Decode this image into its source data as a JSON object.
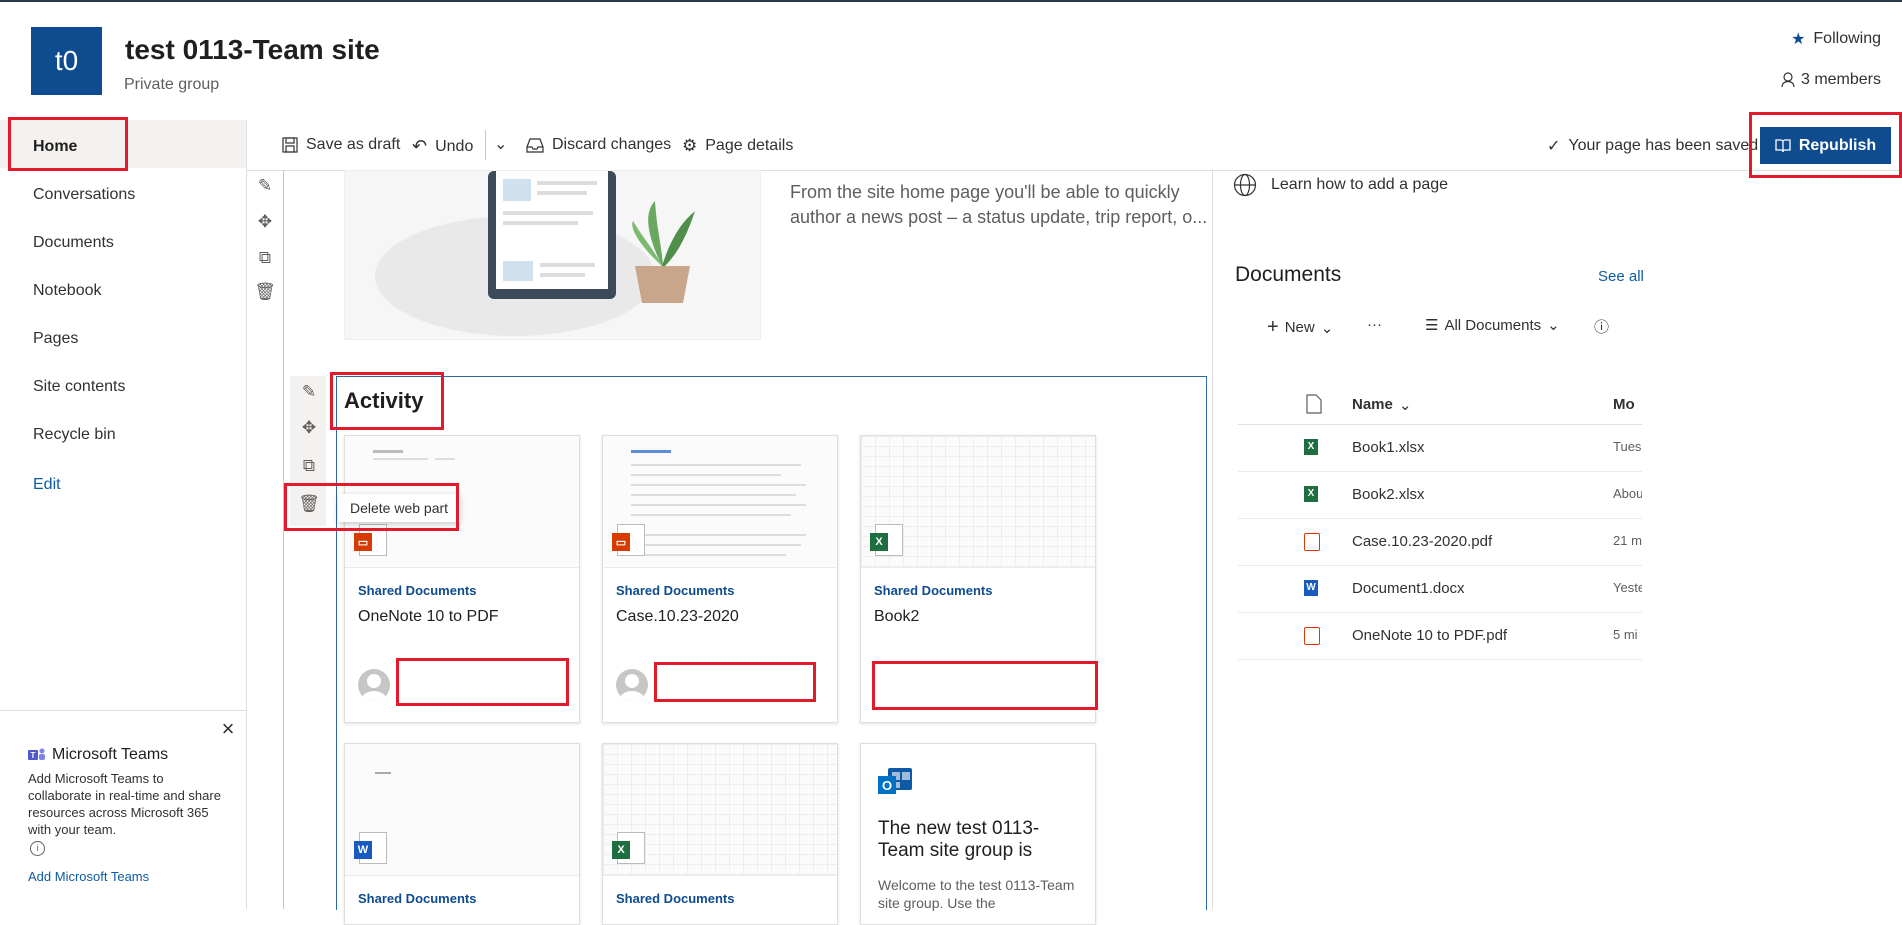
{
  "site": {
    "logo_text": "t0",
    "title": "test 0113-Team site",
    "subtitle": "Private group",
    "following": "Following",
    "members": "3 members"
  },
  "nav": {
    "items": [
      {
        "label": "Home"
      },
      {
        "label": "Conversations"
      },
      {
        "label": "Documents"
      },
      {
        "label": "Notebook"
      },
      {
        "label": "Pages"
      },
      {
        "label": "Site contents"
      },
      {
        "label": "Recycle bin"
      },
      {
        "label": "Edit"
      }
    ]
  },
  "toolbar": {
    "save_draft": "Save as draft",
    "undo": "Undo",
    "discard": "Discard changes",
    "page_details": "Page details",
    "saved_status": "Your page has been saved",
    "republish": "Republish"
  },
  "hero": {
    "text": "From the site home page you'll be able to quickly author a news post – a status update, trip report, o..."
  },
  "activity": {
    "title": "Activity",
    "tooltip": "Delete web part",
    "cards": [
      {
        "library": "Shared Documents",
        "name": "OneNote 10 to PDF"
      },
      {
        "library": "Shared Documents",
        "name": "Case.10.23-2020"
      },
      {
        "library": "Shared Documents",
        "name": "Book2"
      },
      {
        "library": "Shared Documents",
        "name": ""
      },
      {
        "library": "Shared Documents",
        "name": ""
      },
      {
        "library": "",
        "name": "The new test 0113-Team site group is",
        "desc": "Welcome to the test 0113-Team site group. Use the"
      }
    ]
  },
  "right": {
    "learn_link": "Learn how to add a page",
    "docs_title": "Documents",
    "see_all": "See all",
    "new_label": "New",
    "more_label": "···",
    "view_label": "All Documents",
    "col_name": "Name",
    "col_modified": "Mo",
    "files": [
      {
        "name": "Book1.xlsx",
        "modified": "Tues",
        "type": "excel"
      },
      {
        "name": "Book2.xlsx",
        "modified": "Abou",
        "type": "excel"
      },
      {
        "name": "Case.10.23-2020.pdf",
        "modified": "21 m",
        "type": "pdf"
      },
      {
        "name": "Document1.docx",
        "modified": "Yeste",
        "type": "word"
      },
      {
        "name": "OneNote 10 to PDF.pdf",
        "modified": "5 mi",
        "type": "pdf"
      }
    ]
  },
  "teams": {
    "title": "Microsoft Teams",
    "desc": "Add Microsoft Teams to collaborate in real-time and share resources across Microsoft 365 with your team.",
    "link": "Add Microsoft Teams"
  },
  "colors": {
    "brand": "#0f4b8f",
    "link": "#0f5aa6",
    "highlight": "#e3192c",
    "excel": "#1d6f42",
    "word": "#185abd",
    "pdf": "#d83b01"
  }
}
